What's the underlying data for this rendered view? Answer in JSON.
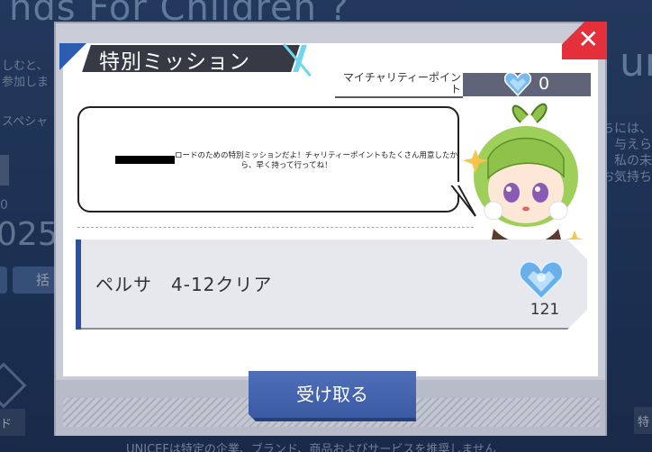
{
  "background": {
    "title": "nds For Children ?",
    "left_lines": [
      "しむと、",
      "参加しま",
      "スペシャ"
    ],
    "left_number_small": "0",
    "left_number_big": "025",
    "left_button": "括",
    "left_tag": "ド",
    "right_lines": [
      "ちには、",
      "与えら",
      "私の未",
      "お気持ち"
    ],
    "right_big": "ur",
    "right_tag": "特",
    "bottom_text": "UNICEFは特定の企業、ブランド、商品およびサービスを推奨しません"
  },
  "modal": {
    "title": "特別ミッション",
    "points_label": "マイチャリティーポイント",
    "points_value": "0",
    "message": "ロードのための特別ミッションだよ！チャリティーポイントもたくさん用意したから、早く持って行ってね！",
    "mission_name": "ペルサ　4-12クリア",
    "reward_count": "121",
    "accept_label": "受け取る",
    "close_label": "✕"
  },
  "icons": {
    "close": "close-icon",
    "points": "heart-gem-icon",
    "reward": "heart-gem-icon"
  },
  "colors": {
    "accent_blue": "#2e4f9c",
    "close_red": "#e3303a",
    "highlight_cyan": "#6fd6ee"
  }
}
